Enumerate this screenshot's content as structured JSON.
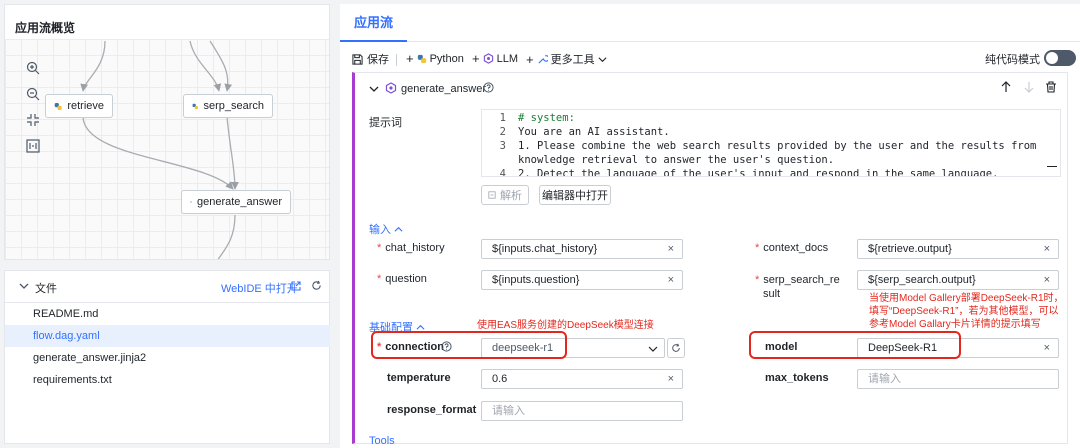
{
  "overview": {
    "title": "应用流概览",
    "nodes": {
      "retrieve": "retrieve",
      "serp_search": "serp_search",
      "generate_answer": "generate_answer"
    }
  },
  "files": {
    "title": "文件",
    "webide_label": "WebIDE 中打开",
    "items": [
      {
        "name": "README.md",
        "active": false
      },
      {
        "name": "flow.dag.yaml",
        "active": true
      },
      {
        "name": "generate_answer.jinja2",
        "active": false
      },
      {
        "name": "requirements.txt",
        "active": false
      }
    ]
  },
  "editor": {
    "tab": "应用流",
    "toolbar": {
      "save": "保存",
      "python": "Python",
      "llm": "LLM",
      "more_tools": "更多工具",
      "code_mode": "纯代码模式"
    },
    "node": {
      "title": "generate_answer",
      "prompt_label": "提示词",
      "code_lines": [
        {
          "no": "1",
          "text": "# system:"
        },
        {
          "no": "2",
          "text": "You are an AI assistant."
        },
        {
          "no": "3",
          "text": "1. Please combine the web search results provided by the user and the results from"
        },
        {
          "no": "",
          "text": "knowledge retrieval to answer the user's question."
        },
        {
          "no": "4",
          "text": "2. Detect the language of the user's input and respond in the same language."
        }
      ],
      "parse_button": "解析",
      "open_editor_button": "编辑器中打开",
      "inputs_section": "输入",
      "inputs": {
        "chat_history": {
          "label": "chat_history",
          "value": "${inputs.chat_history}"
        },
        "context_docs": {
          "label": "context_docs",
          "value": "${retrieve.output}"
        },
        "question": {
          "label": "question",
          "value": "${inputs.question}"
        },
        "serp_search_result": {
          "label_line1": "serp_search_re",
          "label_line2": "sult",
          "value": "${serp_search.output}"
        }
      },
      "basic_section": "基础配置",
      "config": {
        "connection": {
          "label": "connection",
          "value": "deepseek-r1"
        },
        "model": {
          "label": "model",
          "value": "DeepSeek-R1"
        },
        "temperature": {
          "label": "temperature",
          "value": "0.6"
        },
        "max_tokens": {
          "label": "max_tokens",
          "placeholder": "请输入"
        },
        "response_format": {
          "label": "response_format",
          "placeholder": "请输入"
        }
      },
      "tools_section": "Tools"
    },
    "annotations": {
      "connection_note": "使用EAS服务创建的DeepSeek模型连接",
      "model_note_line1": "当使用Model Gallery部署DeepSeek-R1时，",
      "model_note_line2": "填写“DeepSeek-R1”，若为其他模型，可以",
      "model_note_line3": "参考Model Gallary卡片详情的提示填写"
    }
  },
  "colors": {
    "accent": "#3370ff",
    "node_border": "#a839d1",
    "annotation": "#e4271e",
    "active_file_bg": "#e8f0fe"
  }
}
